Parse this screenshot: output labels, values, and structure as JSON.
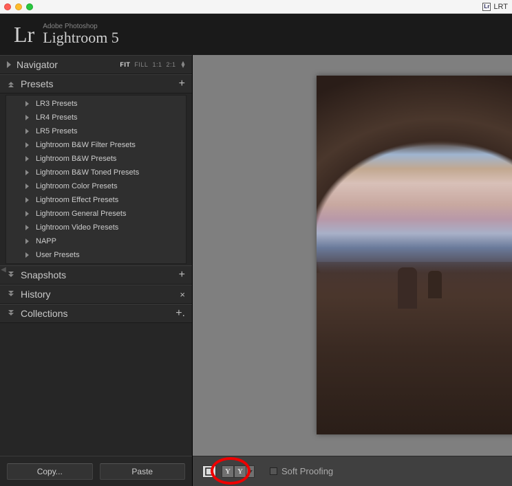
{
  "macbar": {
    "right_label": "LRT"
  },
  "brand": {
    "logo": "Lr",
    "small": "Adobe Photoshop",
    "product": "Lightroom 5"
  },
  "navigator": {
    "title": "Navigator",
    "zoom": {
      "fit": "FIT",
      "fill": "FILL",
      "one": "1:1",
      "two": "2:1"
    }
  },
  "presets": {
    "title": "Presets",
    "items": [
      "LR3 Presets",
      "LR4 Presets",
      "LR5 Presets",
      "Lightroom B&W Filter Presets",
      "Lightroom B&W Presets",
      "Lightroom B&W Toned Presets",
      "Lightroom Color Presets",
      "Lightroom Effect Presets",
      "Lightroom General Presets",
      "Lightroom Video Presets",
      "NAPP",
      "User Presets"
    ]
  },
  "snapshots": {
    "title": "Snapshots"
  },
  "history": {
    "title": "History"
  },
  "collections": {
    "title": "Collections"
  },
  "buttons": {
    "copy": "Copy...",
    "paste": "Paste"
  },
  "softproof": {
    "label": "Soft Proofing"
  },
  "compare": {
    "y1": "Y",
    "y2": "Y"
  }
}
